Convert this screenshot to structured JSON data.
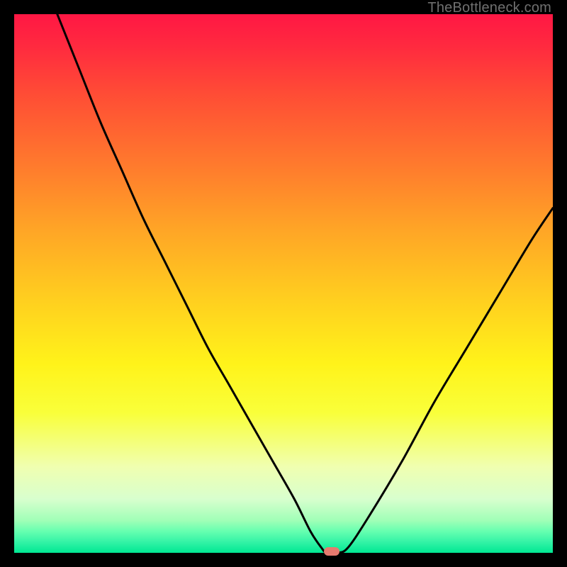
{
  "attribution": "TheBottleneck.com",
  "chart_data": {
    "type": "line",
    "title": "",
    "xlabel": "",
    "ylabel": "",
    "xlim": [
      0,
      100
    ],
    "ylim": [
      0,
      100
    ],
    "grid": false,
    "legend": false,
    "series": [
      {
        "name": "curve",
        "x": [
          8,
          12,
          16,
          20,
          24,
          28,
          32,
          36,
          40,
          44,
          48,
          52,
          55,
          57,
          58,
          60,
          62,
          66,
          72,
          78,
          84,
          90,
          96,
          100
        ],
        "y": [
          100,
          90,
          80,
          71,
          62,
          54,
          46,
          38,
          31,
          24,
          17,
          10,
          4,
          1,
          0,
          0,
          1,
          7,
          17,
          28,
          38,
          48,
          58,
          64
        ]
      }
    ],
    "marker": {
      "x": 59,
      "y": 0,
      "color": "#e77a6f"
    },
    "background_gradient": {
      "top": "#ff1744",
      "bottom": "#00e893"
    }
  }
}
